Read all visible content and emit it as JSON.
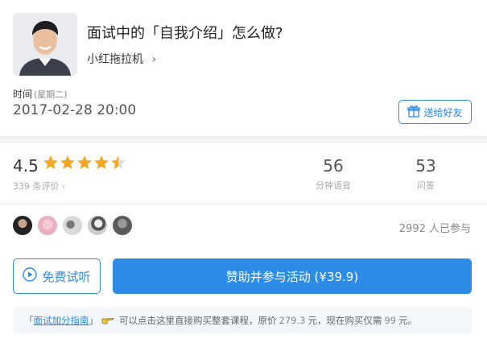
{
  "course": {
    "title": "面试中的「自我介绍」怎么做?",
    "author": "小红拖拉机",
    "author_chevron": "›",
    "time_label": "时间",
    "weekday": "(星期二)",
    "datetime": "2017-02-28 20:00",
    "gift_button": "送给好友"
  },
  "stats": {
    "rating": "4.5",
    "rating_value": 4.5,
    "review_count_text": "339 条评价",
    "review_chevron": "›",
    "audio_minutes": "56",
    "audio_label": "分钟语音",
    "questions": "53",
    "questions_label": "问答"
  },
  "participants": {
    "count_text": "2992 人已参与"
  },
  "actions": {
    "trial_label": "免费试听",
    "join_label": "赞助并参与活动 (¥39.9)"
  },
  "tip": {
    "bracket_open": "「",
    "link_text": "面试加分指南",
    "bracket_close": "」",
    "text_a": "可以点击这里直接购买整套课程，原价",
    "orig_price": "279.3",
    "text_b": "元，现在购买仅需",
    "sale_price": "99",
    "text_c": "元。"
  },
  "colors": {
    "accent": "#2d8ce6",
    "star": "#f5a623",
    "star_empty": "#dddddd"
  },
  "icons": {
    "gift": "gift-icon",
    "play": "play-circle-icon",
    "hand": "pointing-hand-icon",
    "star": "star-icon"
  }
}
